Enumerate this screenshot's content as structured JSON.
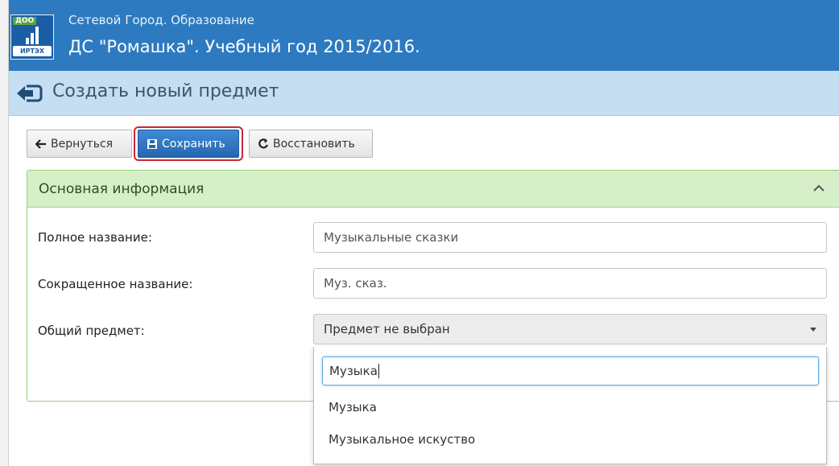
{
  "header": {
    "logo_top": "ДОО",
    "logo_bottom": "ИРТЭХ",
    "subtitle": "Сетевой Город. Образование",
    "title": "ДС \"Ромашка\". Учебный год 2015/2016."
  },
  "page": {
    "title": "Создать новый предмет"
  },
  "toolbar": {
    "back_label": "Вернуться",
    "save_label": "Сохранить",
    "restore_label": "Восстановить"
  },
  "section": {
    "title": "Основная информация"
  },
  "form": {
    "full_name_label": "Полное название:",
    "full_name_value": "Музыкальные сказки",
    "short_name_label": "Сокращенное название:",
    "short_name_value": "Муз. сказ.",
    "general_subject_label": "Общий предмет:",
    "general_subject_value": "Предмет не выбран"
  },
  "dropdown": {
    "search_value": "Музыка",
    "options": [
      "Музыка",
      "Музыкальное искуство"
    ]
  },
  "colors": {
    "header": "#2d7ac0",
    "titlebar": "#c6def2",
    "section": "#d6efc9",
    "save_button": "#2f7ac6",
    "highlight": "#c9273b"
  }
}
